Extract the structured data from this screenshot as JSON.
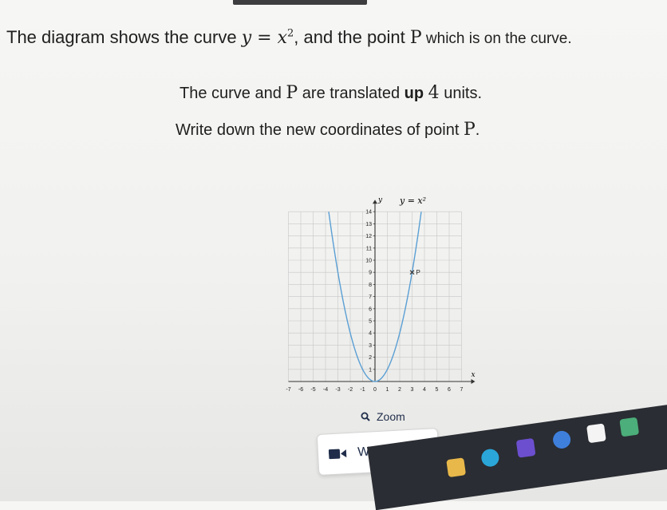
{
  "question": {
    "line1": {
      "prefix": "The diagram shows the curve ",
      "eq_lhs": "y",
      "eq_mid": " = ",
      "eq_rhs": "x",
      "eq_exp": "2",
      "suffix_a": ", and the point ",
      "point": "P",
      "suffix_b": " which is on the curve."
    },
    "line2": {
      "prefix": "The curve and ",
      "point": "P",
      "mid": " are translated ",
      "emph": "up",
      "amount": "4",
      "suffix": " units."
    },
    "line3": {
      "prefix": "Write down the new coordinates of point ",
      "point": "P",
      "suffix": "."
    }
  },
  "chart_data": {
    "type": "line",
    "curve_label": "y = x²",
    "xlabel": "x",
    "ylabel": "y",
    "xlim": [
      -7,
      7
    ],
    "ylim": [
      0,
      14
    ],
    "x_ticks": [
      "-7",
      "-6",
      "-5",
      "-4",
      "-3",
      "-2",
      "-1",
      "0",
      "1",
      "2",
      "3",
      "4",
      "5",
      "6",
      "7"
    ],
    "y_ticks": [
      "1",
      "2",
      "3",
      "4",
      "5",
      "6",
      "7",
      "8",
      "9",
      "10",
      "11",
      "12",
      "13",
      "14"
    ],
    "series": [
      {
        "x": [
          -3.74,
          -3.5,
          -3,
          -2.5,
          -2,
          -1.5,
          -1,
          -0.5,
          0,
          0.5,
          1,
          1.5,
          2,
          2.5,
          3,
          3.5,
          3.74
        ],
        "y": [
          14,
          12.25,
          9,
          6.25,
          4,
          2.25,
          1,
          0.25,
          0,
          0.25,
          1,
          2.25,
          4,
          6.25,
          9,
          12.25,
          14
        ]
      }
    ],
    "points": [
      {
        "label": "P",
        "x": 3,
        "y": 9
      }
    ],
    "grid": true,
    "colors": {
      "curve": "#5a9fd4",
      "grid": "#c7c7c7",
      "axes": "#333333",
      "point": "#333333"
    }
  },
  "controls": {
    "zoom_label": "Zoom",
    "zoom_icon": "magnifier-icon",
    "watch_label": "Watch video",
    "watch_icon": "video-icon"
  }
}
